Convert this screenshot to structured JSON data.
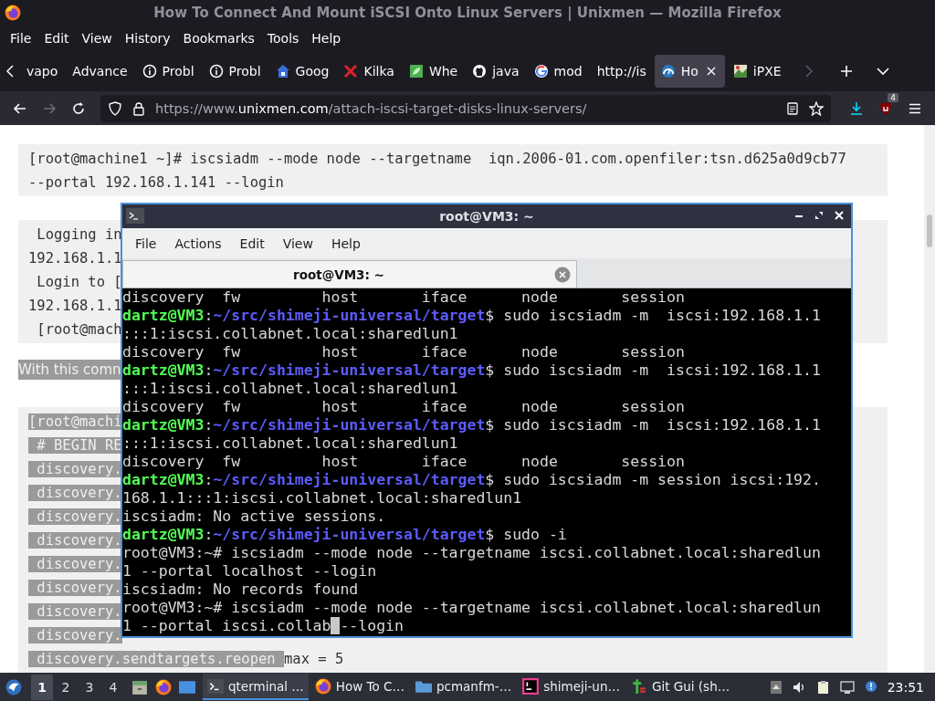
{
  "window": {
    "title": "How To Connect And Mount iSCSI Onto Linux Servers | Unixmen — Mozilla Firefox"
  },
  "menu": [
    "File",
    "Edit",
    "View",
    "History",
    "Bookmarks",
    "Tools",
    "Help"
  ],
  "tabs": [
    {
      "label": "vapo",
      "kind": "none",
      "selected": false
    },
    {
      "label": "Advance",
      "kind": "none",
      "selected": false
    },
    {
      "label": "Probl",
      "kind": "info",
      "selected": false
    },
    {
      "label": "Probl",
      "kind": "info",
      "selected": false
    },
    {
      "label": "Goog",
      "kind": "house",
      "selected": false
    },
    {
      "label": "Kilka",
      "kind": "cross",
      "selected": false
    },
    {
      "label": "Whe",
      "kind": "leaf",
      "selected": false
    },
    {
      "label": "java",
      "kind": "github",
      "selected": false
    },
    {
      "label": "mod",
      "kind": "google",
      "selected": false
    },
    {
      "label": "http://is",
      "kind": "none",
      "selected": false
    },
    {
      "label": "Ho",
      "kind": "gauge",
      "selected": true
    },
    {
      "label": "iPXE",
      "kind": "photo",
      "selected": false
    }
  ],
  "address": {
    "scheme": "https://www.",
    "domain": "unixmen.com",
    "path": "/attach-iscsi-target-disks-linux-servers/"
  },
  "extension_badge": "4",
  "content": [
    {
      "kind": "code",
      "lines": [
        {
          "text": "[root@machine1 ~]# iscsiadm --mode node --targetname  iqn.2006-01.com.openfiler:tsn.d625a0d9cb77",
          "selected": false
        },
        {
          "text": "--portal 192.168.1.141 --login",
          "selected": false
        }
      ]
    },
    {
      "kind": "code",
      "lines": [
        {
          "text": " Logging in",
          "selected": false
        },
        {
          "text": "192.168.1.1",
          "selected": false
        },
        {
          "text": " Login to [",
          "selected": false
        },
        {
          "text": "192.168.1.1",
          "selected": false
        },
        {
          "text": " [root@mach",
          "selected": false
        }
      ]
    },
    {
      "kind": "paragraph",
      "text": "With this comn",
      "selected": true
    },
    {
      "kind": "code",
      "lines": [
        {
          "text": "[root@machi",
          "selected": true
        },
        {
          "text": " # BEGIN RE",
          "selected": true
        },
        {
          "text": " discovery.",
          "selected": true
        },
        {
          "text": " discovery.",
          "selected": true
        },
        {
          "text": " discovery.",
          "selected": true
        },
        {
          "text": " discovery.",
          "selected": true
        },
        {
          "text": " discovery.",
          "selected": true
        },
        {
          "text": " discovery.",
          "selected": true
        },
        {
          "text": " discovery.",
          "selected": true
        },
        {
          "text": " discovery.",
          "selected": true
        },
        {
          "text": " discovery.sendtargets.reopen ",
          "selected": true,
          "rest": "max = 5"
        }
      ]
    }
  ],
  "terminal": {
    "title": "root@VM3: ~",
    "menu": [
      "File",
      "Actions",
      "Edit",
      "View",
      "Help"
    ],
    "tab": "root@VM3: ~",
    "lines": [
      {
        "kind": "output",
        "text": "discovery  fw         host       iface      node       session"
      },
      {
        "kind": "prompt",
        "user": "dartz@VM3",
        "separator": ":",
        "path": "~/src/shimeji-universal/target",
        "command": "$ sudo iscsiadm -m  iscsi:192.168.1.1"
      },
      {
        "kind": "output",
        "text": ":::1:iscsi.collabnet.local:sharedlun1"
      },
      {
        "kind": "output",
        "text": "discovery  fw         host       iface      node       session"
      },
      {
        "kind": "prompt",
        "user": "dartz@VM3",
        "separator": ":",
        "path": "~/src/shimeji-universal/target",
        "command": "$ sudo iscsiadm -m  iscsi:192.168.1.1"
      },
      {
        "kind": "output",
        "text": ":::1:iscsi.collabnet.local:sharedlun1"
      },
      {
        "kind": "output",
        "text": "discovery  fw         host       iface      node       session"
      },
      {
        "kind": "prompt",
        "user": "dartz@VM3",
        "separator": ":",
        "path": "~/src/shimeji-universal/target",
        "command": "$ sudo iscsiadm -m  iscsi:192.168.1.1"
      },
      {
        "kind": "output",
        "text": ":::1:iscsi.collabnet.local:sharedlun1"
      },
      {
        "kind": "output",
        "text": "discovery  fw         host       iface      node       session"
      },
      {
        "kind": "prompt",
        "user": "dartz@VM3",
        "separator": ":",
        "path": "~/src/shimeji-universal/target",
        "command": "$ sudo iscsiadm -m session iscsi:192."
      },
      {
        "kind": "output",
        "text": "168.1.1:::1:iscsi.collabnet.local:sharedlun1"
      },
      {
        "kind": "output",
        "text": "iscsiadm: No active sessions."
      },
      {
        "kind": "prompt",
        "user": "dartz@VM3",
        "separator": ":",
        "path": "~/src/shimeji-universal/target",
        "command": "$ sudo -i"
      },
      {
        "kind": "output",
        "text": "root@VM3:~# iscsiadm --mode node --targetname iscsi.collabnet.local:sharedlun"
      },
      {
        "kind": "output",
        "text": "1 --portal localhost --login"
      },
      {
        "kind": "output",
        "text": "iscsiadm: No records found"
      },
      {
        "kind": "output",
        "text": "root@VM3:~# iscsiadm --mode node --targetname iscsi.collabnet.local:sharedlun"
      },
      {
        "kind": "cursor",
        "before": "1 --portal iscsi.collab",
        "after": "--login"
      }
    ]
  },
  "taskbar": {
    "workspaces": [
      {
        "label": "1",
        "selected": true
      },
      {
        "label": "2",
        "selected": false
      },
      {
        "label": "3",
        "selected": false
      },
      {
        "label": "4",
        "selected": false
      }
    ],
    "tasks": [
      {
        "label": "qterminal …",
        "kind": "terminal",
        "selected": true
      },
      {
        "label": "How To C…",
        "kind": "firefox",
        "selected": false
      },
      {
        "label": "pcmanfm-…",
        "kind": "folder",
        "selected": false
      },
      {
        "label": "shimeji-un…",
        "kind": "ide",
        "selected": false
      },
      {
        "label": "Git Gui (sh…",
        "kind": "git",
        "selected": false
      }
    ],
    "clock": "23:51"
  }
}
